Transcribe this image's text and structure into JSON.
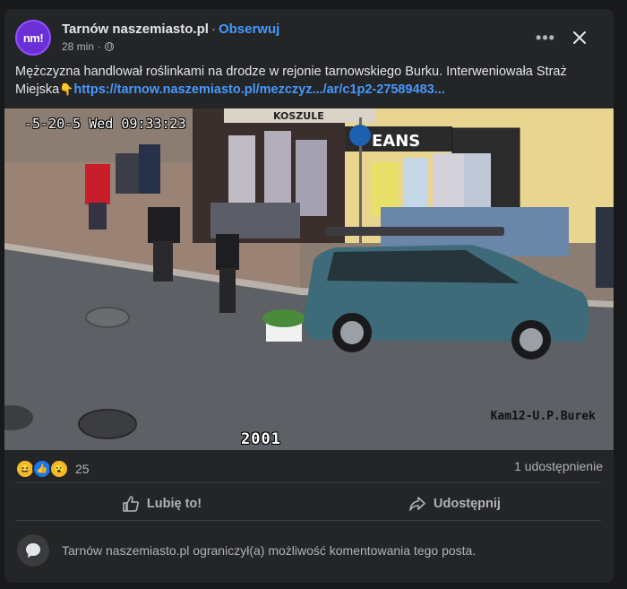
{
  "post": {
    "page_name": "Tarnów naszemiasto.pl",
    "avatar_text": "nm!",
    "separator": "·",
    "follow_label": "Obserwuj",
    "time": "28 min",
    "time_sep": "·",
    "text": "Mężczyzna handlował roślinkami na drodze w rejonie tarnowskiego Burku. Interweniowała Straż Miejska",
    "link": "https://tarnow.naszemiasto.pl/mezczyz.../ar/c1p2-27589483...",
    "privacy_icon": "globe-icon",
    "more_icon": "more-options-icon",
    "close_icon": "close-icon"
  },
  "media": {
    "osd_time": "-5-20-5 Wed 09:33:23",
    "osd_cam": "Kam12-U.P.Burek",
    "osd_number": "2001",
    "sign_text": "KOSZULE",
    "sign_text2": "EANS"
  },
  "engagement": {
    "reaction_icons": [
      "haha-icon",
      "like-icon",
      "wow-icon"
    ],
    "reaction_count": "25",
    "shares": "1 udostępnienie",
    "like_label": "Lubię to!",
    "share_label": "Udostępnij"
  },
  "comments": {
    "notice": "Tarnów naszemiasto.pl ograniczył(a) możliwość komentowania tego posta."
  },
  "colors": {
    "background": "#18191a",
    "card": "#242526",
    "link": "#4599ff",
    "car": "#3e6b7a"
  }
}
